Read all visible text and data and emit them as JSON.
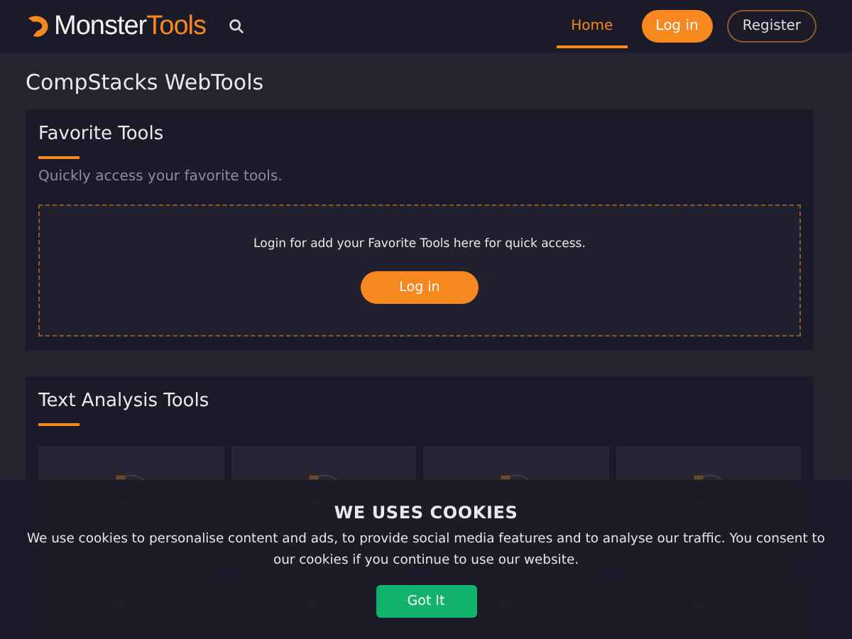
{
  "header": {
    "logo": {
      "part_1": "Monster",
      "part_2": "Tools"
    },
    "nav": [
      {
        "label": "Home",
        "selected": true
      }
    ],
    "login_button": "Log in",
    "register_button": "Register"
  },
  "page_title": "CompStacks WebTools",
  "favorites": {
    "title": "Favorite Tools",
    "subtitle": "Quickly access your favorite tools.",
    "message": "Login for add your Favorite Tools here for quick access.",
    "button": "Log in"
  },
  "text_analysis": {
    "title": "Text Analysis Tools",
    "tools": [
      {
        "kind": "card"
      },
      {
        "kind": "card"
      },
      {
        "kind": "card"
      },
      {
        "kind": "card"
      },
      {
        "kind": "card"
      },
      {
        "kind": "card"
      },
      {
        "kind": "card"
      },
      {
        "kind": "card"
      }
    ]
  },
  "cookie_banner": {
    "title": "WE USES COOKIES",
    "message": "We use cookies to personalise content and ads, to provide social media features and to analyse our traffic. You consent to our cookies if you continue to use our website.",
    "button": "Got It"
  }
}
